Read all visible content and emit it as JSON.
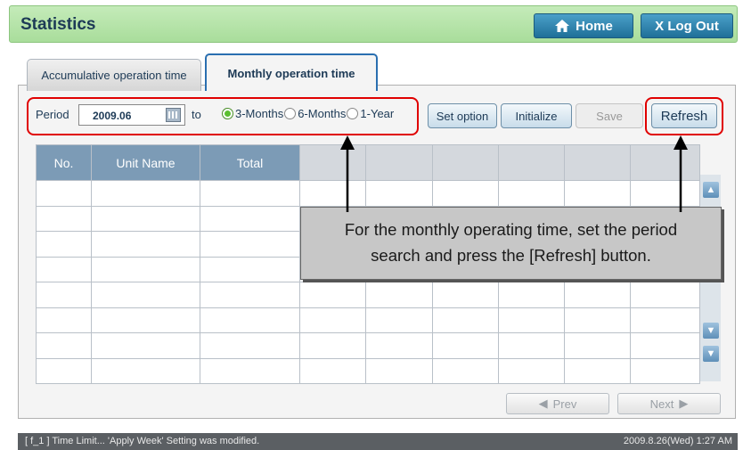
{
  "header": {
    "title": "Statistics",
    "home_label": "Home",
    "logout_label": "X Log Out"
  },
  "tabs": [
    {
      "label": "Accumulative operation time",
      "active": false
    },
    {
      "label": "Monthly operation time",
      "active": true
    }
  ],
  "filter": {
    "period_label": "Period",
    "date_value": "2009.06",
    "to_label": "to",
    "radio_options": [
      "3-Months",
      "6-Months",
      "1-Year"
    ],
    "selected_option": "3-Months"
  },
  "actions": {
    "set_option": "Set option",
    "initialize": "Initialize",
    "save": "Save",
    "refresh": "Refresh"
  },
  "table": {
    "columns": [
      "No.",
      "Unit Name",
      "Total",
      "",
      "",
      "",
      "",
      "",
      ""
    ]
  },
  "pagination": {
    "prev": "Prev",
    "next": "Next"
  },
  "callout": {
    "line1": "For the monthly operating time, set the period",
    "line2": "search and press the [Refresh] button."
  },
  "status": {
    "message": "[ f_1 ] Time Limit... 'Apply Week' Setting was modified.",
    "datetime": "2009.8.26(Wed)  1:27 AM"
  },
  "colors": {
    "title_bar": "#b5e3a8",
    "accent_blue": "#2a7fb0",
    "highlight_red": "#e00000"
  }
}
